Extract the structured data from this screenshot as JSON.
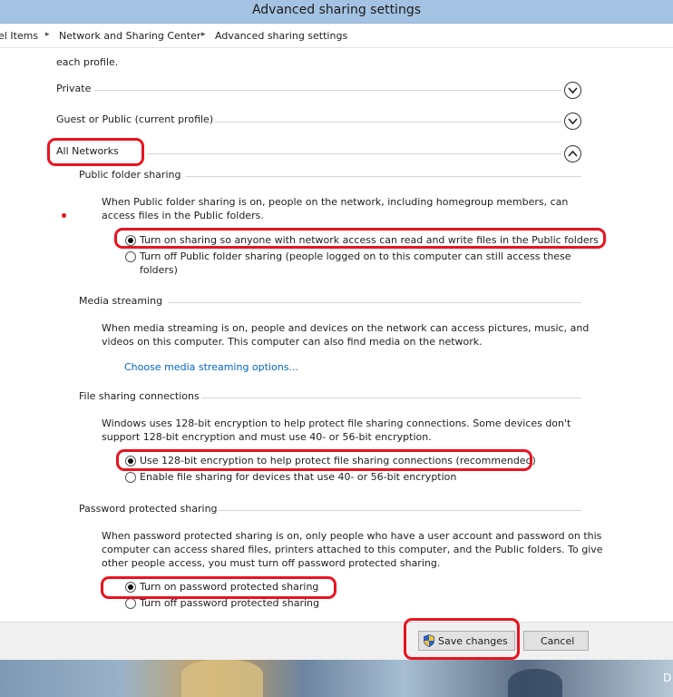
{
  "window": {
    "title": "Advanced sharing settings"
  },
  "breadcrumb": {
    "items": [
      "el Items",
      "Network and Sharing Center",
      "Advanced sharing settings"
    ],
    "separator": "▸"
  },
  "intro_text": "each profile.",
  "profiles": {
    "private": {
      "label": "Private",
      "icon": "chevron-down-icon"
    },
    "guest": {
      "label": "Guest or Public (current profile)",
      "icon": "chevron-down-icon"
    },
    "all": {
      "label": "All Networks",
      "icon": "chevron-up-icon"
    }
  },
  "sections": {
    "public_folder": {
      "heading": "Public folder sharing",
      "description_lines": [
        "When Public folder sharing is on, people on the network, including homegroup members, can",
        "access files in the Public folders."
      ],
      "options": [
        {
          "label": "Turn on sharing so anyone with network access can read and write files in the Public folders",
          "checked": true
        },
        {
          "label_lines": [
            "Turn off Public folder sharing (people logged on to this computer can still access these",
            "folders)"
          ],
          "checked": false
        }
      ]
    },
    "media": {
      "heading": "Media streaming",
      "description_lines": [
        "When media streaming is on, people and devices on the network can access pictures, music, and",
        "videos on this computer. This computer can also find media on the network."
      ],
      "link": "Choose media streaming options..."
    },
    "file_sharing": {
      "heading": "File sharing connections",
      "description_lines": [
        "Windows uses 128-bit encryption to help protect file sharing connections. Some devices don't",
        "support 128-bit encryption and must use 40- or 56-bit encryption."
      ],
      "options": [
        {
          "label": "Use 128-bit encryption to help protect file sharing connections (recommended)",
          "checked": true
        },
        {
          "label": "Enable file sharing for devices that use 40- or 56-bit encryption",
          "checked": false
        }
      ]
    },
    "password": {
      "heading": "Password protected sharing",
      "description_lines": [
        "When password protected sharing is on, only people who have a user account and password on this",
        "computer can access shared files, printers attached to this computer, and the Public folders. To give",
        "other people access, you must turn off password protected sharing."
      ],
      "options": [
        {
          "label": "Turn on password protected sharing",
          "checked": true
        },
        {
          "label": "Turn off password protected sharing",
          "checked": false
        }
      ]
    }
  },
  "footer": {
    "save_label": "Save changes",
    "save_icon": "uac-shield-icon",
    "cancel_label": "Cancel"
  },
  "desktop": {
    "edge_text": "D"
  },
  "colors": {
    "titlebar": "#a4c3e3",
    "link": "#0066cc",
    "annotation": "#e8141f"
  }
}
